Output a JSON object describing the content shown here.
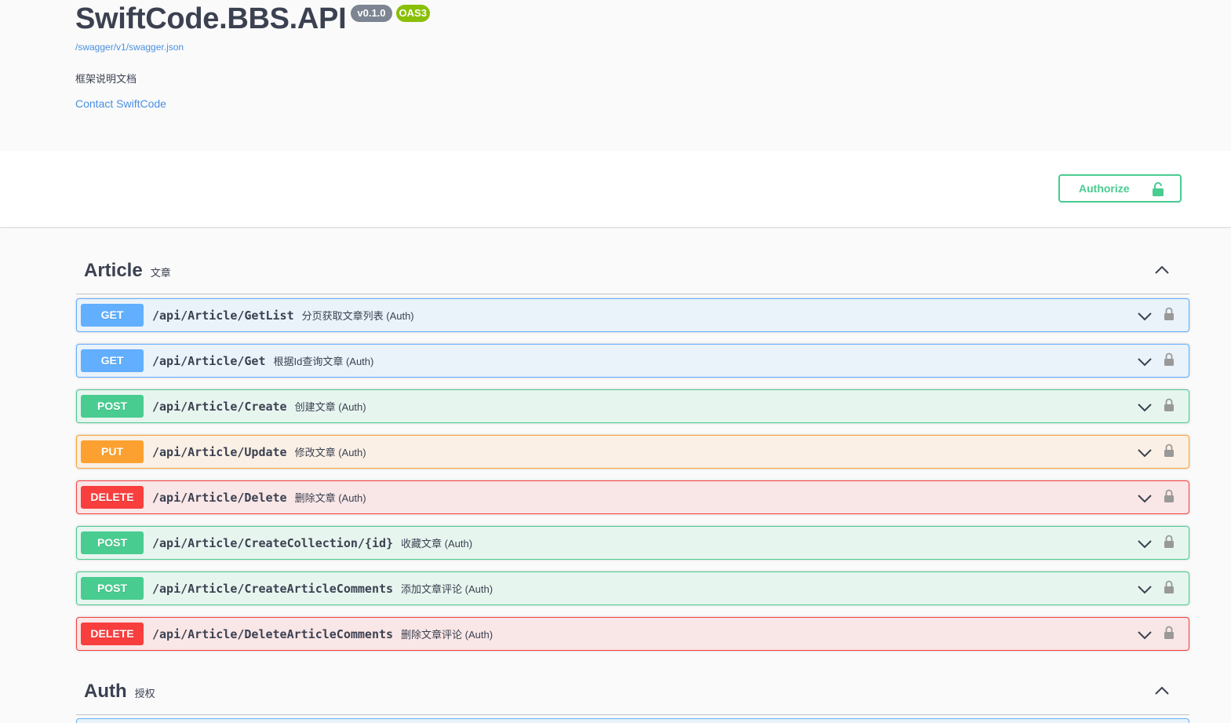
{
  "info": {
    "title": "SwiftCode.BBS.API",
    "version": "v0.1.0",
    "oas": "OAS3",
    "spec_url": "/swagger/v1/swagger.json",
    "description": "框架说明文档",
    "contact": "Contact SwiftCode"
  },
  "scheme": {
    "authorize_label": "Authorize"
  },
  "colors": {
    "get": "#61affe",
    "post": "#49cc90",
    "put": "#fca130",
    "delete": "#f93e3e",
    "link": "#4990e2"
  },
  "tags": [
    {
      "name": "Article",
      "description": "文章",
      "operations": [
        {
          "method": "GET",
          "path": "/api/Article/GetList",
          "summary": "分页获取文章列表 (Auth)"
        },
        {
          "method": "GET",
          "path": "/api/Article/Get",
          "summary": "根据Id查询文章 (Auth)"
        },
        {
          "method": "POST",
          "path": "/api/Article/Create",
          "summary": "创建文章 (Auth)"
        },
        {
          "method": "PUT",
          "path": "/api/Article/Update",
          "summary": "修改文章 (Auth)"
        },
        {
          "method": "DELETE",
          "path": "/api/Article/Delete",
          "summary": "删除文章 (Auth)"
        },
        {
          "method": "POST",
          "path": "/api/Article/CreateCollection/{id}",
          "summary": "收藏文章 (Auth)"
        },
        {
          "method": "POST",
          "path": "/api/Article/CreateArticleComments",
          "summary": "添加文章评论 (Auth)"
        },
        {
          "method": "DELETE",
          "path": "/api/Article/DeleteArticleComments",
          "summary": "删除文章评论 (Auth)"
        }
      ]
    },
    {
      "name": "Auth",
      "description": "授权",
      "operations": []
    }
  ]
}
